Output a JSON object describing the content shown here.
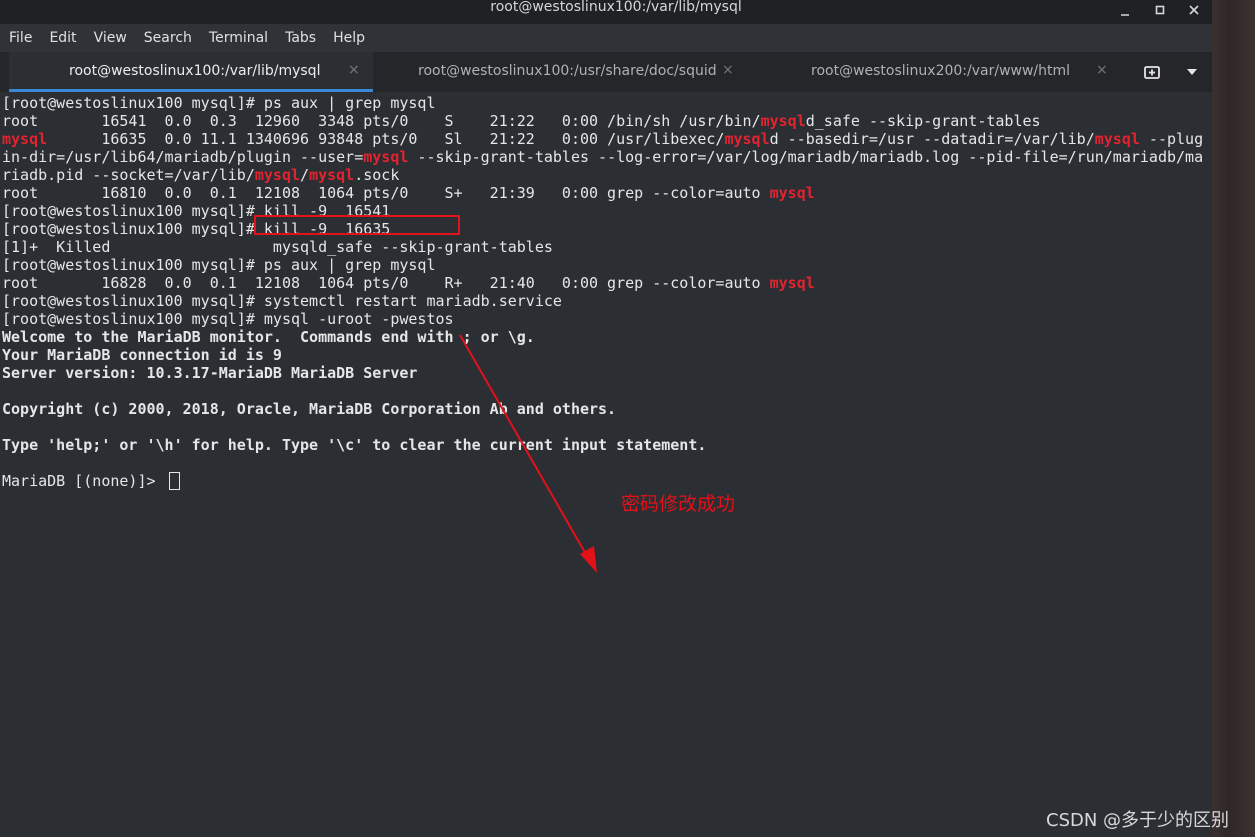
{
  "window": {
    "title": "root@westoslinux100:/var/lib/mysql",
    "controls": {
      "minimize": "minimize-icon",
      "maximize": "maximize-icon",
      "close": "close-icon"
    }
  },
  "menu": [
    "File",
    "Edit",
    "View",
    "Search",
    "Terminal",
    "Tabs",
    "Help"
  ],
  "tabs": [
    {
      "label": "root@westoslinux100:/var/lib/mysql",
      "active": true
    },
    {
      "label": "root@westoslinux100:/usr/share/doc/squid",
      "active": false
    },
    {
      "label": "root@westoslinux200:/var/www/html",
      "active": false
    }
  ],
  "tab_close_glyph": "×",
  "tab_buttons": {
    "new_tab": "new-tab-icon",
    "menu": "chevron-down-icon"
  },
  "terminal": {
    "lines": [
      [
        {
          "t": "[root@westoslinux100 mysql]# ps aux | grep mysql"
        }
      ],
      [
        {
          "t": "root       16541  0.0  0.3  12960  3348 pts/0    S    21:22   0:00 /bin/sh /usr/bin/"
        },
        {
          "t": "mysql",
          "s": "red"
        },
        {
          "t": "d_safe --skip-grant-tables"
        }
      ],
      [
        {
          "t": "mysql",
          "s": "red"
        },
        {
          "t": "      16635  0.0 11.1 1340696 93848 pts/0   Sl   21:22   0:00 /usr/libexec/"
        },
        {
          "t": "mysql",
          "s": "red"
        },
        {
          "t": "d --basedir=/usr --datadir=/var/lib/"
        },
        {
          "t": "mysql",
          "s": "red"
        },
        {
          "t": " --plug"
        }
      ],
      [
        {
          "t": "in-dir=/usr/lib64/mariadb/plugin --user="
        },
        {
          "t": "mysql",
          "s": "red"
        },
        {
          "t": " --skip-grant-tables --log-error=/var/log/mariadb/mariadb.log --pid-file=/run/mariadb/ma"
        }
      ],
      [
        {
          "t": "riadb.pid --socket=/var/lib/"
        },
        {
          "t": "mysql",
          "s": "red"
        },
        {
          "t": "/"
        },
        {
          "t": "mysql",
          "s": "red"
        },
        {
          "t": ".sock"
        }
      ],
      [
        {
          "t": "root       16810  0.0  0.1  12108  1064 pts/0    S+   21:39   0:00 grep --color=auto "
        },
        {
          "t": "mysql",
          "s": "red"
        }
      ],
      [
        {
          "t": "[root@westoslinux100 mysql]# kill -9  16541"
        }
      ],
      [
        {
          "t": "[root@westoslinux100 mysql]# kill -9  16635"
        }
      ],
      [
        {
          "t": "[1]+  Killed                  mysqld_safe --skip-grant-tables"
        }
      ],
      [
        {
          "t": "[root@westoslinux100 mysql]# ps aux | grep mysql"
        }
      ],
      [
        {
          "t": "root       16828  0.0  0.1  12108  1064 pts/0    R+   21:40   0:00 grep --color=auto "
        },
        {
          "t": "mysql",
          "s": "red"
        }
      ],
      [
        {
          "t": "[root@westoslinux100 mysql]# systemctl restart mariadb.service"
        }
      ],
      [
        {
          "t": "[root@westoslinux100 mysql]# mysql -uroot -pwestos"
        }
      ],
      [
        {
          "t": "Welcome to the MariaDB monitor.  Commands end with ; or \\g.",
          "s": "bold"
        }
      ],
      [
        {
          "t": "Your MariaDB connection id is 9",
          "s": "bold"
        }
      ],
      [
        {
          "t": "Server version: 10.3.17-MariaDB MariaDB Server",
          "s": "bold"
        }
      ],
      [
        {
          "t": ""
        }
      ],
      [
        {
          "t": "Copyright (c) 2000, 2018, Oracle, MariaDB Corporation Ab and others.",
          "s": "bold"
        }
      ],
      [
        {
          "t": ""
        }
      ],
      [
        {
          "t": "Type 'help;' or '\\h' for help. Type '\\c' to clear the current input statement.",
          "s": "bold"
        }
      ],
      [
        {
          "t": ""
        }
      ],
      [
        {
          "t": "MariaDB [(none)]> "
        },
        {
          "cursor": true
        }
      ]
    ]
  },
  "annotation": {
    "text": "密码修改成功",
    "color": "#e3111a"
  },
  "watermark": "CSDN @多于少的区别",
  "colors": {
    "highlight": "#e3232f",
    "accent": "#3a88d8",
    "background": "#2b2e33"
  }
}
